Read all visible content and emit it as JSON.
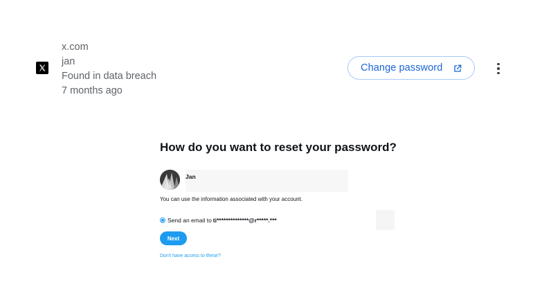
{
  "breach": {
    "site": "x.com",
    "username": "jan",
    "status": "Found in data breach",
    "time": "7 months ago",
    "logo_icon": "x-logo-icon",
    "change_password_label": "Change password",
    "external_icon": "open-in-new-icon",
    "more_icon": "more-vert-icon"
  },
  "reset": {
    "title": "How do you want to reset your password?",
    "account_name": "Jan",
    "info": "You can use the information associated with your account.",
    "email_option_prefix": "Send an email to",
    "email_masked": "ti**************@r*****.***",
    "next_label": "Next",
    "no_access_link": "Don't have access to these?"
  },
  "colors": {
    "accent_blue": "#1a65d6",
    "twitter_blue": "#1d9bf0",
    "button_border": "#a8c7fa",
    "muted_text": "#5f6368"
  }
}
